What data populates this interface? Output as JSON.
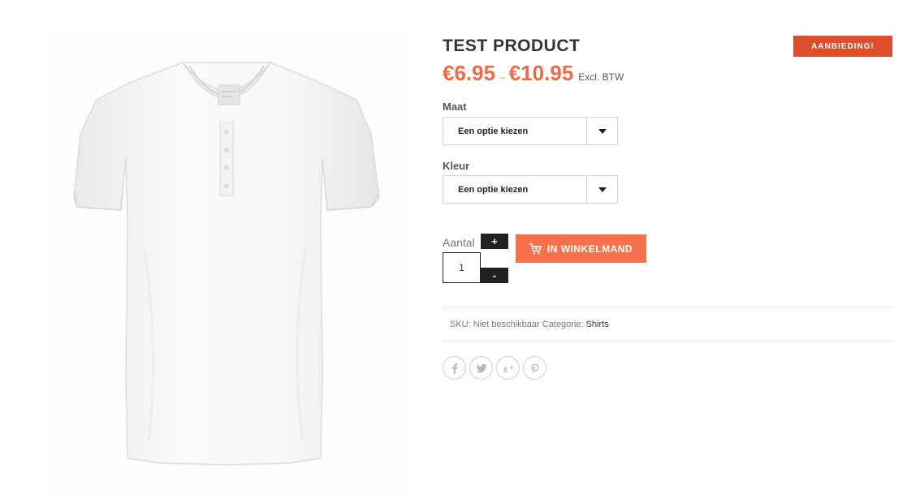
{
  "product": {
    "title": "TEST PRODUCT",
    "badge": "AANBIEDING!",
    "price_low": "€6.95",
    "price_sep": "–",
    "price_high": "€10.95",
    "price_note": "Excl. BTW",
    "image_icon": "white-v-neck-tshirt-photo"
  },
  "options": [
    {
      "label": "Maat",
      "value": "Een optie kiezen",
      "icon": "chevron-down-icon"
    },
    {
      "label": "Kleur",
      "value": "Een optie kiezen",
      "icon": "chevron-down-icon"
    }
  ],
  "quantity": {
    "label": "Aantal",
    "value": "1",
    "plus": "+",
    "minus": "-"
  },
  "cart": {
    "label": "IN WINKELMAND",
    "icon": "cart-add-icon"
  },
  "meta": {
    "sku_label": "SKU:",
    "sku_value": "Niet beschikbaar",
    "category_label": "Categorie:",
    "category_value": "Shirts"
  },
  "social": [
    "facebook-icon",
    "twitter-icon",
    "google-plus-icon",
    "pinterest-icon"
  ],
  "colors": {
    "accent": "#f06a42",
    "badge": "#dd4e2a",
    "cart_button": "#f7714a",
    "dark": "#222222"
  }
}
